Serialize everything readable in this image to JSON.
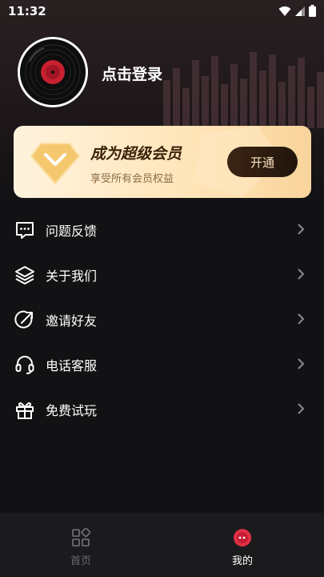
{
  "status_bar": {
    "time": "11:32"
  },
  "profile": {
    "login_text": "点击登录"
  },
  "vip": {
    "title": "成为超级会员",
    "subtitle": "享受所有会员权益",
    "button_label": "开通"
  },
  "menu": [
    {
      "label": "问题反馈",
      "icon": "feedback-icon"
    },
    {
      "label": "关于我们",
      "icon": "layers-icon"
    },
    {
      "label": "邀请好友",
      "icon": "share-icon"
    },
    {
      "label": "电话客服",
      "icon": "headset-icon"
    },
    {
      "label": "免费试玩",
      "icon": "gift-icon"
    }
  ],
  "tabbar": [
    {
      "label": "首页",
      "icon": "grid-icon",
      "active": false
    },
    {
      "label": "我的",
      "icon": "vinyl-icon",
      "active": true
    }
  ],
  "colors": {
    "background": "#121214",
    "vip_gradient_start": "#fff3dd",
    "vip_gradient_end": "#f9d49b",
    "vip_button": "#2b1a0f",
    "accent_red": "#e23045",
    "tab_inactive": "#6b6b70"
  }
}
